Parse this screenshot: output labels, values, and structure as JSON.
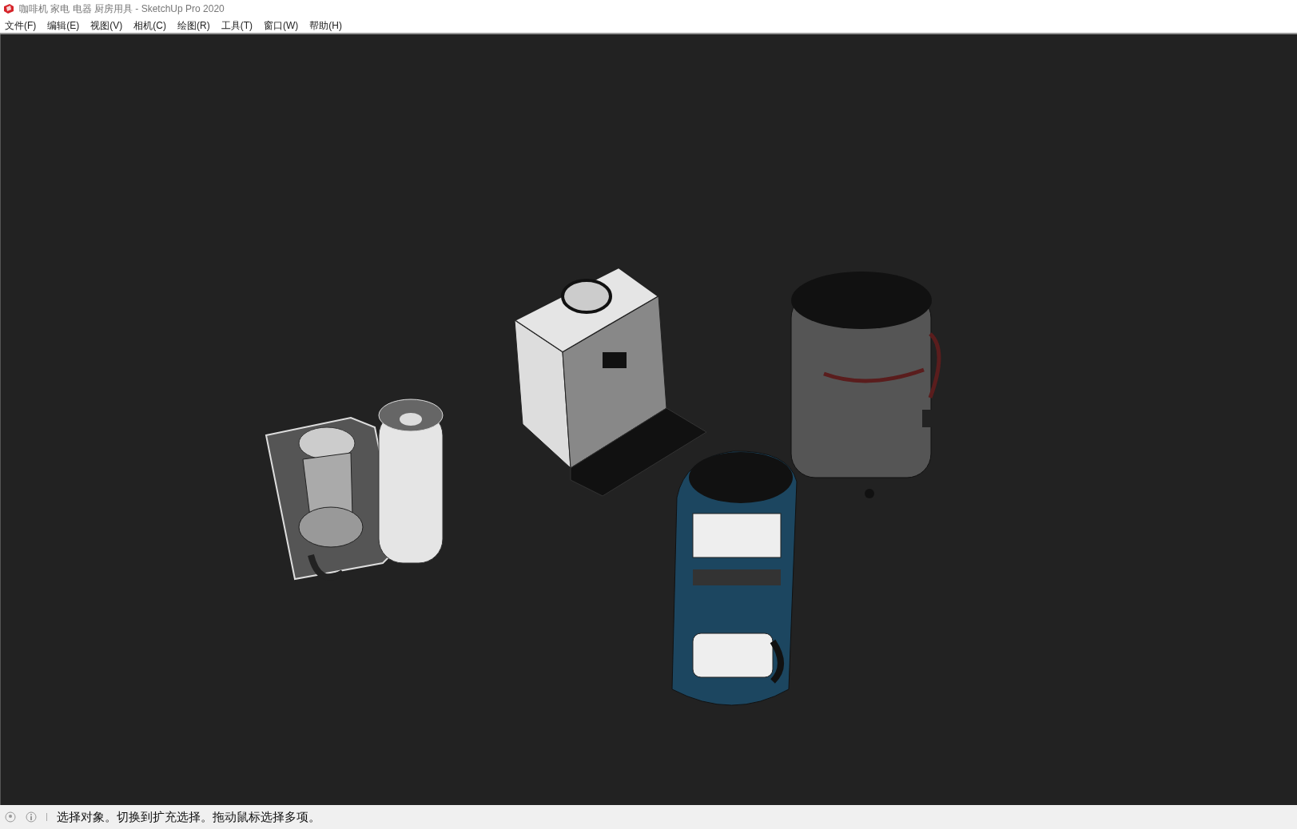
{
  "window": {
    "title": "咖啡机 家电 电器 厨房用具 - SketchUp Pro 2020"
  },
  "menu": [
    "文件(F)",
    "编辑(E)",
    "视图(V)",
    "相机(C)",
    "绘图(R)",
    "工具(T)",
    "窗口(W)",
    "帮助(H)"
  ],
  "status_bar": {
    "message": "选择对象。切换到扩充选择。拖动鼠标选择多项。"
  }
}
